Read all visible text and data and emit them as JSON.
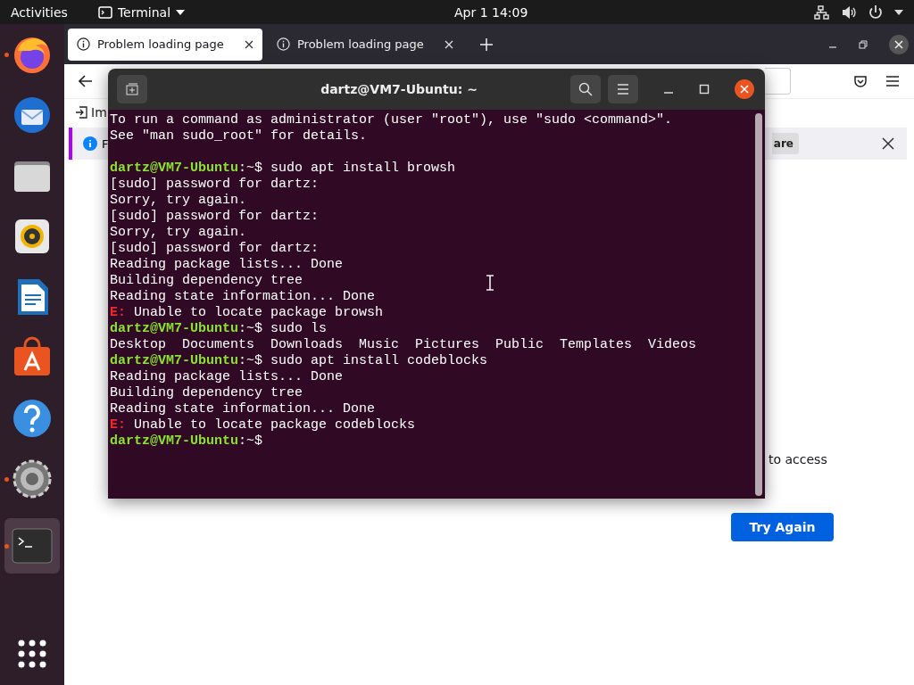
{
  "top_bar": {
    "activities": "Activities",
    "app_menu": "Terminal",
    "clock": "Apr 1  14:09"
  },
  "dock": [
    {
      "kind": "firefox",
      "running": true,
      "selected": false
    },
    {
      "kind": "thunderbird",
      "running": false,
      "selected": false
    },
    {
      "kind": "files",
      "running": false,
      "selected": false
    },
    {
      "kind": "rhythmbox",
      "running": false,
      "selected": false
    },
    {
      "kind": "writer",
      "running": false,
      "selected": false
    },
    {
      "kind": "software",
      "running": false,
      "selected": false
    },
    {
      "kind": "help",
      "running": false,
      "selected": false
    },
    {
      "kind": "settings",
      "running": true,
      "selected": false
    },
    {
      "kind": "terminal",
      "running": true,
      "selected": true
    }
  ],
  "browser": {
    "tabs": [
      {
        "label": "Problem loading page",
        "selected": true
      },
      {
        "label": "Problem loading page",
        "selected": false
      }
    ],
    "bookmarks_text": "Im",
    "notification": {
      "text": "F",
      "button": "are"
    },
    "page_text": "to access",
    "try_again": "Try Again"
  },
  "terminal": {
    "title": "dartz@VM7-Ubuntu: ~",
    "lines": [
      {
        "kind": "plain",
        "text": "To run a command as administrator (user \"root\"), use \"sudo <command>\"."
      },
      {
        "kind": "plain",
        "text": "See \"man sudo_root\" for details."
      },
      {
        "kind": "blank"
      },
      {
        "kind": "prompt",
        "user": "dartz@VM7-Ubuntu",
        "path": ":~$",
        "command": "sudo apt install browsh"
      },
      {
        "kind": "plain",
        "text": "[sudo] password for dartz:"
      },
      {
        "kind": "plain",
        "text": "Sorry, try again."
      },
      {
        "kind": "plain",
        "text": "[sudo] password for dartz:"
      },
      {
        "kind": "plain",
        "text": "Sorry, try again."
      },
      {
        "kind": "plain",
        "text": "[sudo] password for dartz:"
      },
      {
        "kind": "plain",
        "text": "Reading package lists... Done"
      },
      {
        "kind": "plain",
        "text": "Building dependency tree"
      },
      {
        "kind": "plain",
        "text": "Reading state information... Done"
      },
      {
        "kind": "error",
        "prefix": "E:",
        "text": "Unable to locate package browsh"
      },
      {
        "kind": "prompt",
        "user": "dartz@VM7-Ubuntu",
        "path": ":~$",
        "command": "sudo ls"
      },
      {
        "kind": "plain",
        "text": "Desktop  Documents  Downloads  Music  Pictures  Public  Templates  Videos"
      },
      {
        "kind": "prompt",
        "user": "dartz@VM7-Ubuntu",
        "path": ":~$",
        "command": "sudo apt install codeblocks"
      },
      {
        "kind": "plain",
        "text": "Reading package lists... Done"
      },
      {
        "kind": "plain",
        "text": "Building dependency tree"
      },
      {
        "kind": "plain",
        "text": "Reading state information... Done"
      },
      {
        "kind": "error",
        "prefix": "E:",
        "text": "Unable to locate package codeblocks"
      },
      {
        "kind": "prompt",
        "user": "dartz@VM7-Ubuntu",
        "path": ":~$"
      }
    ]
  }
}
